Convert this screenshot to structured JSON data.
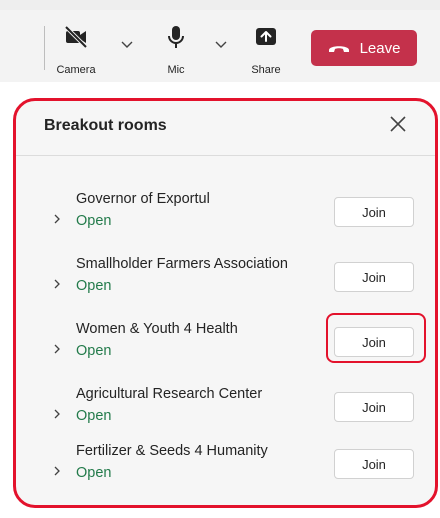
{
  "toolbar": {
    "camera": {
      "label": "Camera",
      "icon": "camera-off-icon"
    },
    "mic": {
      "label": "Mic",
      "icon": "microphone-icon"
    },
    "share": {
      "label": "Share",
      "icon": "share-screen-icon"
    },
    "leave": {
      "label": "Leave",
      "icon": "phone-hangup-icon",
      "color": "#c4314b"
    }
  },
  "panel": {
    "title": "Breakout rooms",
    "highlight_color": "#e3122c",
    "rooms": [
      {
        "name": "Governor of Exportul",
        "status": "Open",
        "join": "Join"
      },
      {
        "name": "Smallholder Farmers Association",
        "status": "Open",
        "join": "Join"
      },
      {
        "name": "Women & Youth 4 Health",
        "status": "Open",
        "join": "Join",
        "highlighted": true
      },
      {
        "name": "Agricultural Research Center",
        "status": "Open",
        "join": "Join"
      },
      {
        "name": "Fertilizer & Seeds 4 Humanity",
        "status": "Open",
        "join": "Join"
      }
    ],
    "status_color": "#237b4b"
  }
}
